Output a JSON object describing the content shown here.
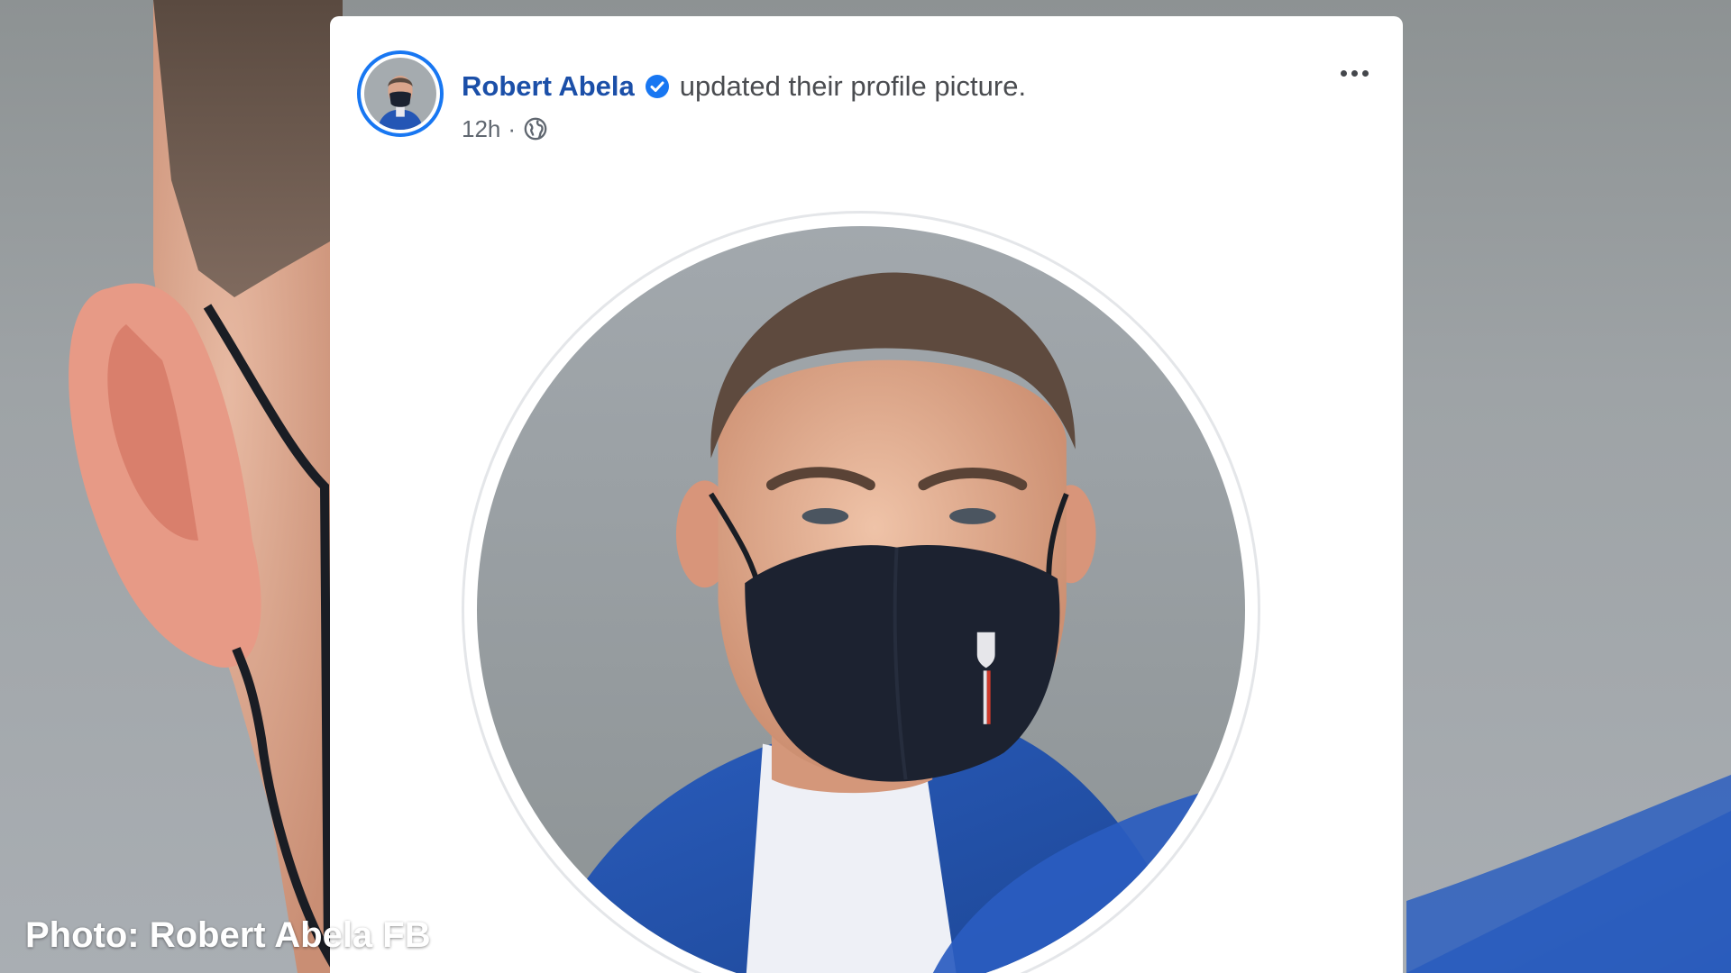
{
  "post": {
    "author_name": "Robert Abela",
    "action_text": "updated their profile picture.",
    "timestamp": "12h",
    "separator": "·",
    "privacy_icon": "globe-icon",
    "verified_icon": "verified-badge-icon",
    "menu_icon": "more-options-icon"
  },
  "caption": {
    "text": "Photo: Robert Abela FB"
  },
  "colors": {
    "author_link": "#1b4fa8",
    "verified_badge": "#1877f2",
    "avatar_ring": "#1877f2",
    "mask": "#1c2230",
    "jacket": "#2456b5"
  }
}
